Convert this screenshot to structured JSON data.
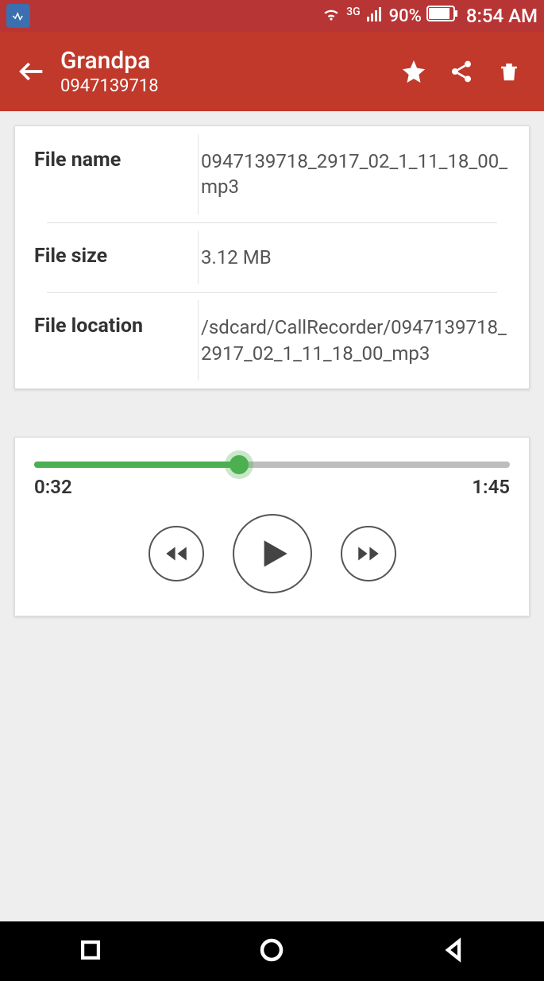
{
  "status": {
    "network_type": "3G",
    "battery_percent": "90%",
    "clock": "8:54 AM"
  },
  "header": {
    "title": "Grandpa",
    "subtitle": "0947139718"
  },
  "info": {
    "rows": [
      {
        "label": "File name",
        "value": "0947139718_2917_02_1_11_18_00_mp3"
      },
      {
        "label": "File size",
        "value": "3.12 MB"
      },
      {
        "label": "File location",
        "value": "/sdcard/CallRecorder/0947139718_2917_02_1_11_18_00_mp3"
      }
    ]
  },
  "player": {
    "elapsed": "0:32",
    "duration": "1:45",
    "progress_percent": 43
  }
}
